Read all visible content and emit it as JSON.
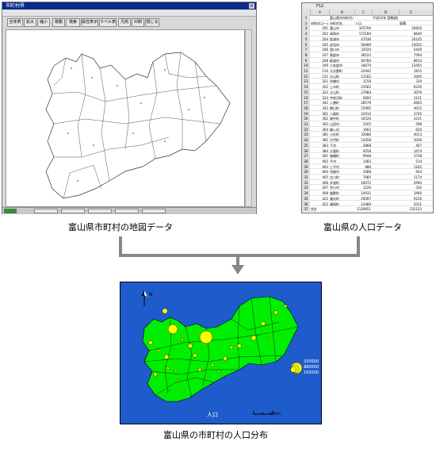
{
  "captions": {
    "map_data": "富山県市町村の地図データ",
    "population_data": "富山県の人口データ",
    "result": "富山県の市町村の人口分布"
  },
  "map_window": {
    "title": "市町村界",
    "toolbar": [
      "全体表示",
      "拡大",
      "縮小",
      "移動",
      "検索",
      "属性表示",
      "ラベル表示",
      "凡例",
      "印刷",
      "閉じる"
    ]
  },
  "spreadsheet": {
    "headers": [
      "A",
      "B",
      "C",
      "D",
      "E"
    ],
    "name_box": "F12",
    "rows": [
      [
        "",
        "富山県内市町村人口",
        "",
        "平成12年 国勢調査",
        ""
      ],
      [
        "市町村コード",
        "市町村名",
        "人口",
        "",
        "面積"
      ],
      [
        "201",
        "富山市",
        "325700",
        "",
        "20816"
      ],
      [
        "202",
        "高岡市",
        "172184",
        "",
        "8640"
      ],
      [
        "204",
        "魚津市",
        "47036",
        "",
        "20145"
      ],
      [
        "205",
        "氷見市",
        "56489",
        "",
        "23055"
      ],
      [
        "206",
        "滑川市",
        "33520",
        "",
        "5429"
      ],
      [
        "207",
        "黒部市",
        "36522",
        "",
        "7594"
      ],
      [
        "208",
        "砺波市",
        "40784",
        "",
        "8614"
      ],
      [
        "209",
        "小矢部市",
        "34670",
        "",
        "13405"
      ],
      [
        "210",
        "大沢野町",
        "22442",
        "",
        "1815"
      ],
      [
        "211",
        "大山町",
        "11502",
        "",
        "2045"
      ],
      [
        "321",
        "舟橋村",
        "2158",
        "",
        "319"
      ],
      [
        "322",
        "上市町",
        "23562",
        "",
        "6230"
      ],
      [
        "323",
        "立山町",
        "27984",
        "",
        "3070"
      ],
      [
        "324",
        "宇奈月町",
        "6693",
        "",
        "1121"
      ],
      [
        "342",
        "入善町",
        "28579",
        "",
        "6665"
      ],
      [
        "343",
        "朝日町",
        "15995",
        "",
        "4015"
      ],
      [
        "361",
        "八尾町",
        "22912",
        "",
        "3745"
      ],
      [
        "362",
        "婦中町",
        "34520",
        "",
        "3231"
      ],
      [
        "363",
        "山田村",
        "2205",
        "",
        "598"
      ],
      [
        "364",
        "細入村",
        "1903",
        "",
        "620"
      ],
      [
        "381",
        "小杉町",
        "33086",
        "",
        "4013"
      ],
      [
        "382",
        "大門町",
        "12658",
        "",
        "2039"
      ],
      [
        "383",
        "下村",
        "2868",
        "",
        "407"
      ],
      [
        "384",
        "大島町",
        "9258",
        "",
        "1474"
      ],
      [
        "401",
        "城端町",
        "9948",
        "",
        "3728"
      ],
      [
        "402",
        "平村",
        "1483",
        "",
        "514"
      ],
      [
        "403",
        "上平村",
        "986",
        "",
        "1102"
      ],
      [
        "404",
        "利賀村",
        "1088",
        "",
        "924"
      ],
      [
        "405",
        "庄川町",
        "7085",
        "",
        "1174"
      ],
      [
        "406",
        "井波町",
        "10072",
        "",
        "2994"
      ],
      [
        "407",
        "井口村",
        "1226",
        "",
        "320"
      ],
      [
        "408",
        "福野町",
        "14932",
        "",
        "3460"
      ],
      [
        "421",
        "福光町",
        "20097",
        "",
        "9126"
      ],
      [
        "422",
        "福岡町",
        "12489",
        "",
        "2011"
      ],
      [
        "合計",
        "",
        "1120851",
        "",
        "232123"
      ]
    ]
  },
  "result_map": {
    "label": "人口",
    "scale_label": "10km",
    "north_label": "N",
    "legend": [
      "320000人",
      "240000",
      "160000"
    ],
    "colors": {
      "sea": "#1e5ccc",
      "land": "#00ee00",
      "circle": "#ffff00"
    }
  }
}
